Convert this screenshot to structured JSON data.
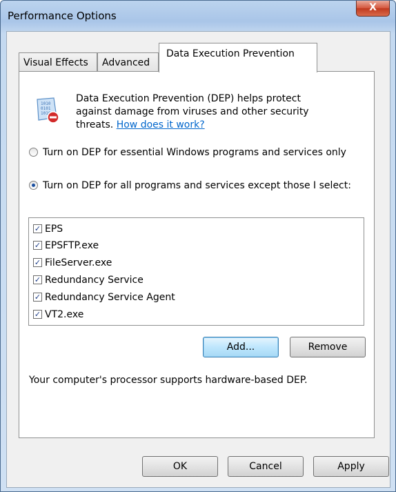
{
  "window": {
    "title": "Performance Options",
    "close_label": "X"
  },
  "tabs": [
    {
      "label": "Visual Effects"
    },
    {
      "label": "Advanced"
    },
    {
      "label": "Data Execution Prevention"
    }
  ],
  "dep": {
    "description": "Data Execution Prevention (DEP) helps protect against damage from viruses and other security threats.",
    "link": "How does it work?",
    "icon": "dep-shield-icon"
  },
  "options": {
    "essential_only": {
      "label": "Turn on DEP for essential Windows programs and services only",
      "selected": false
    },
    "all_except": {
      "label": "Turn on DEP for all programs and services except those I select:",
      "selected": true
    }
  },
  "exceptions": [
    {
      "name": "EPS",
      "checked": true
    },
    {
      "name": "EPSFTP.exe",
      "checked": true
    },
    {
      "name": "FileServer.exe",
      "checked": true
    },
    {
      "name": "Redundancy Service",
      "checked": true
    },
    {
      "name": "Redundancy Service Agent",
      "checked": true
    },
    {
      "name": "VT2.exe",
      "checked": true
    }
  ],
  "list_buttons": {
    "add": "Add...",
    "remove": "Remove"
  },
  "status": "Your computer's processor supports hardware-based DEP.",
  "dialog_buttons": {
    "ok": "OK",
    "cancel": "Cancel",
    "apply": "Apply"
  }
}
